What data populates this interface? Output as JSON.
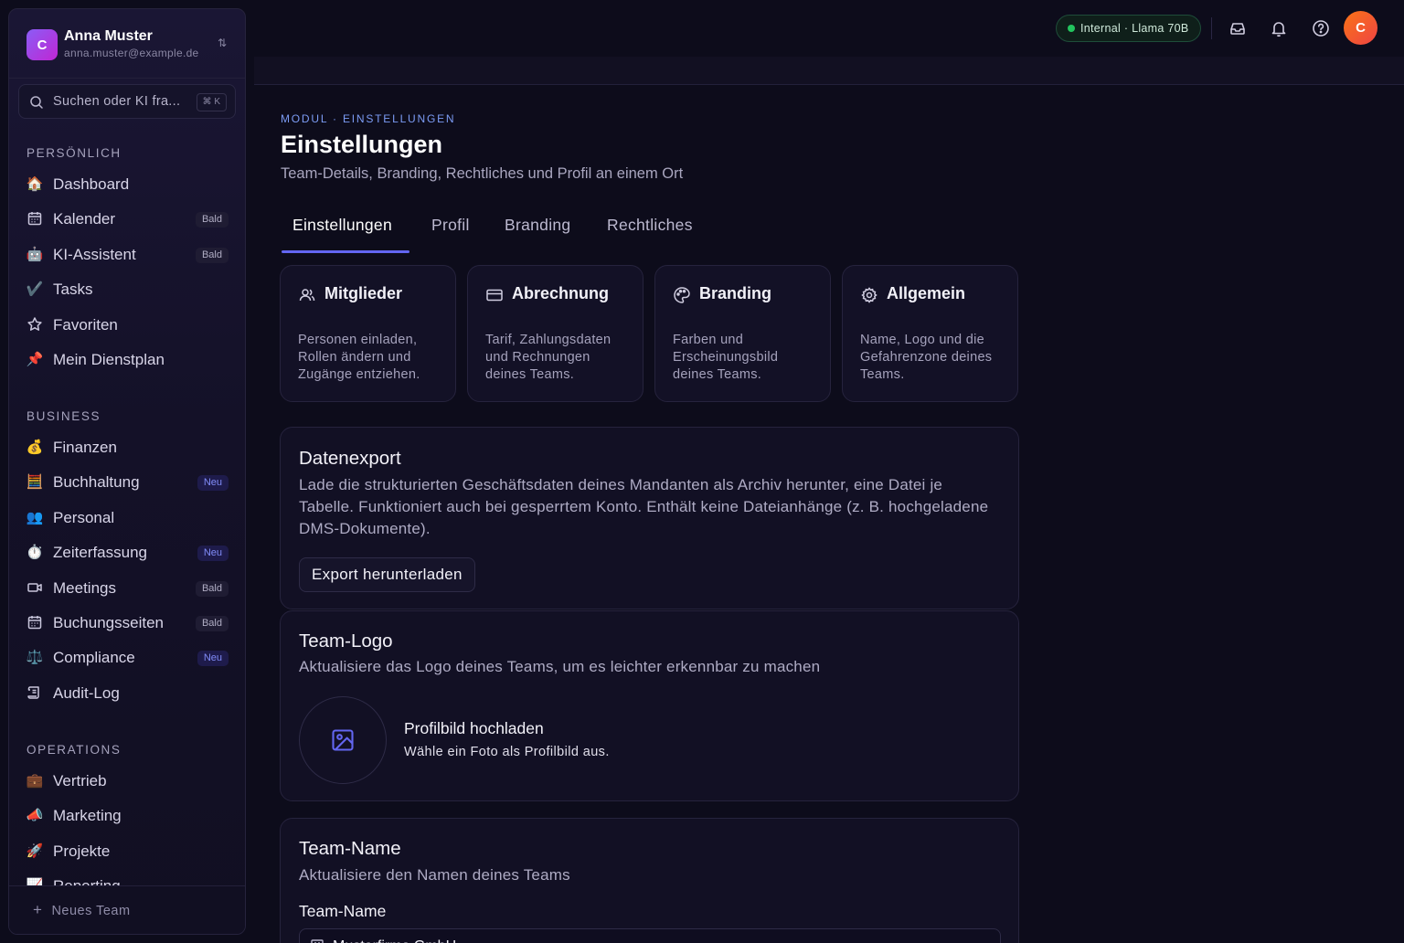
{
  "account": {
    "avatar_letter": "C",
    "name": "Anna Muster",
    "email": "anna.muster@example.de",
    "switch_icon": "chevrons-up-down-icon"
  },
  "search": {
    "placeholder": "Suchen oder KI fra...",
    "shortcut": "⌘ K"
  },
  "sections": {
    "personal": "PERSÖNLICH",
    "business": "BUSINESS",
    "operations": "OPERATIONS"
  },
  "nav_personal": [
    {
      "icon": "🏠",
      "label": "Dashboard",
      "badge": ""
    },
    {
      "icon": "calendar",
      "label": "Kalender",
      "badge": "Bald"
    },
    {
      "icon": "🤖",
      "label": "KI-Assistent",
      "badge": "Bald"
    },
    {
      "icon": "✔️",
      "label": "Tasks",
      "badge": ""
    },
    {
      "icon": "star",
      "label": "Favoriten",
      "badge": ""
    },
    {
      "icon": "📌",
      "label": "Mein Dienstplan",
      "badge": ""
    }
  ],
  "nav_business": [
    {
      "icon": "💰",
      "label": "Finanzen",
      "badge": ""
    },
    {
      "icon": "🧮",
      "label": "Buchhaltung",
      "badge": "Neu"
    },
    {
      "icon": "👥",
      "label": "Personal",
      "badge": ""
    },
    {
      "icon": "⏱️",
      "label": "Zeiterfassung",
      "badge": "Neu"
    },
    {
      "icon": "video",
      "label": "Meetings",
      "badge": "Bald"
    },
    {
      "icon": "calendar",
      "label": "Buchungsseiten",
      "badge": "Bald"
    },
    {
      "icon": "⚖️",
      "label": "Compliance",
      "badge": "Neu"
    },
    {
      "icon": "scroll",
      "label": "Audit-Log",
      "badge": ""
    }
  ],
  "nav_operations": [
    {
      "icon": "💼",
      "label": "Vertrieb",
      "badge": ""
    },
    {
      "icon": "📣",
      "label": "Marketing",
      "badge": ""
    },
    {
      "icon": "🚀",
      "label": "Projekte",
      "badge": ""
    },
    {
      "icon": "📈",
      "label": "Reporting",
      "badge": ""
    }
  ],
  "sidebar_footer": {
    "new_team": "Neues Team"
  },
  "topbar": {
    "model_status": "Internal · Llama 70B",
    "user_avatar_letter": "C"
  },
  "page": {
    "breadcrumb": "MODUL · EINSTELLUNGEN",
    "title": "Einstellungen",
    "subtitle": "Team-Details, Branding, Rechtliches und Profil an einem Ort"
  },
  "tabs": [
    {
      "label": "Einstellungen",
      "active": true
    },
    {
      "label": "Profil",
      "active": false
    },
    {
      "label": "Branding",
      "active": false
    },
    {
      "label": "Rechtliches",
      "active": false
    }
  ],
  "quick_cards": [
    {
      "icon": "users-icon",
      "title": "Mitglieder",
      "desc": "Personen einladen, Rollen ändern und Zugänge entziehen."
    },
    {
      "icon": "credit-card-icon",
      "title": "Abrechnung",
      "desc": "Tarif, Zahlungsdaten und Rechnungen deines Teams."
    },
    {
      "icon": "palette-icon",
      "title": "Branding",
      "desc": "Farben und Erscheinungsbild deines Teams."
    },
    {
      "icon": "gear-icon",
      "title": "Allgemein",
      "desc": "Name, Logo und die Gefahrenzone deines Teams."
    }
  ],
  "data_export": {
    "title": "Datenexport",
    "desc": "Lade die strukturierten Geschäftsdaten deines Mandanten als Archiv herunter, eine Datei je Tabelle. Funktioniert auch bei gesperrtem Konto. Enthält keine Dateianhänge (z. B. hochgeladene DMS-Dokumente).",
    "button": "Export herunterladen"
  },
  "team_logo": {
    "title": "Team-Logo",
    "desc": "Aktualisiere das Logo deines Teams, um es leichter erkennbar zu machen",
    "upload_title": "Profilbild hochladen",
    "upload_desc": "Wähle ein Foto als Profilbild aus."
  },
  "team_name": {
    "title": "Team-Name",
    "desc": "Aktualisiere den Namen deines Teams",
    "field_label": "Team-Name",
    "value": "Musterfirma GmbH"
  },
  "colors": {
    "accent": "#6366f1",
    "breadcrumb": "#7c9cf5",
    "status_green": "#22c55e",
    "avatar_orange": "#f97316"
  }
}
